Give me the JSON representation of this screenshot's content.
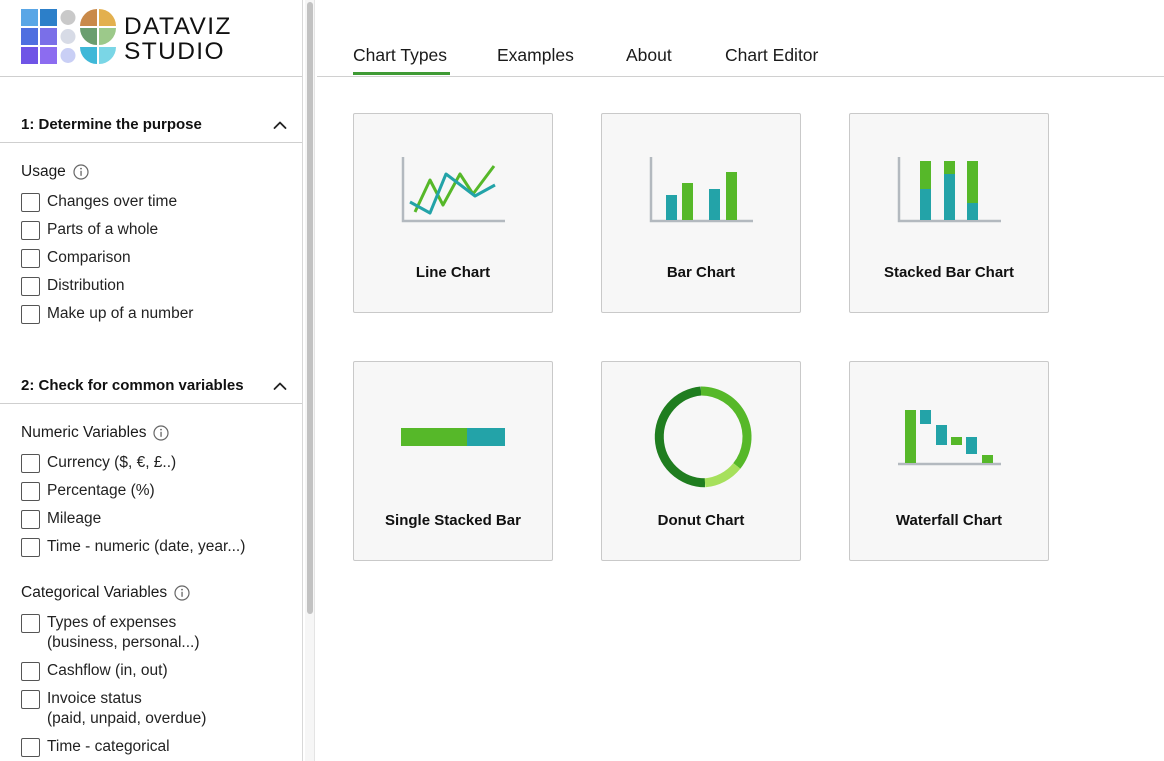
{
  "brand": {
    "line1": "DATAVIZ",
    "line2": "STUDIO"
  },
  "colors": {
    "accent": "#3f9b35",
    "green": "#56b829",
    "teal": "#23a3a8",
    "dark_green": "#1f7d1f",
    "light_green": "#a6e05c",
    "axis": "#b3b9bf"
  },
  "sidebar": {
    "section1": {
      "title": "1: Determine the purpose",
      "icon": "chevron-up-icon"
    },
    "usage": {
      "label": "Usage",
      "icon": "info-icon",
      "options": [
        "Changes over time",
        "Parts of a whole",
        "Comparison",
        "Distribution",
        "Make up of a number"
      ]
    },
    "section2": {
      "title": "2: Check for common variables",
      "icon": "chevron-up-icon"
    },
    "numeric": {
      "label": "Numeric Variables",
      "icon": "info-icon",
      "options": [
        "Currency ($, €, £..)",
        "Percentage (%)",
        "Mileage",
        "Time - numeric (date, year...)"
      ]
    },
    "categorical": {
      "label": "Categorical Variables",
      "icon": "info-icon",
      "options": [
        {
          "line1": "Types of expenses",
          "line2": "(business, personal...)"
        },
        {
          "line1": "Cashflow (in, out)",
          "line2": ""
        },
        {
          "line1": "Invoice status",
          "line2": "(paid, unpaid, overdue)"
        },
        {
          "line1": "Time - categorical",
          "line2": ""
        }
      ]
    }
  },
  "tabs": [
    "Chart Types",
    "Examples",
    "About",
    "Chart Editor"
  ],
  "active_tab": "Chart Types",
  "cards": [
    {
      "title": "Line Chart",
      "icon": "line-chart-icon"
    },
    {
      "title": "Bar Chart",
      "icon": "bar-chart-icon"
    },
    {
      "title": "Stacked Bar Chart",
      "icon": "stacked-bar-chart-icon"
    },
    {
      "title": "Single Stacked Bar",
      "icon": "single-stacked-bar-icon"
    },
    {
      "title": "Donut Chart",
      "icon": "donut-chart-icon"
    },
    {
      "title": "Waterfall Chart",
      "icon": "waterfall-chart-icon"
    }
  ]
}
